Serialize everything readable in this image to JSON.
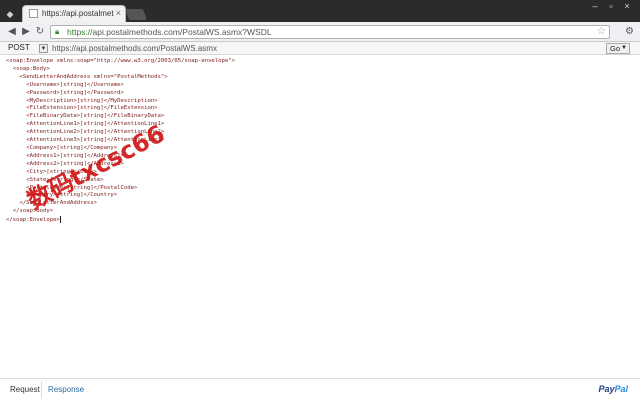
{
  "browser": {
    "tab_title": "https://api.postalmethods.com",
    "url_secure": "https://",
    "url_rest": "api.postalmethods.com/PostalWS.asmx?WSDL"
  },
  "request": {
    "method": "POST",
    "url": "https://api.postalmethods.com/PostalWS.asmx",
    "go_label": "Go"
  },
  "xml_lines": [
    "<soap:Envelope xmlns:soap=\"http://www.w3.org/2003/05/soap-envelope\">",
    "  <soap:Body>",
    "    <SendLetterAndAddress xmlns=\"PostalMethods\">",
    "      <Username>[string]</Username>",
    "      <Password>[string]</Password>",
    "      <MyDescription>[string]</MyDescription>",
    "      <FileExtension>[string]</FileExtension>",
    "      <FileBinaryData>[string]</FileBinaryData>",
    "      <AttentionLine1>[string]</AttentionLine1>",
    "      <AttentionLine2>[string]</AttentionLine2>",
    "      <AttentionLine3>[string]</AttentionLine3>",
    "      <Company>[string]</Company>",
    "      <Address1>[string]</Address1>",
    "      <Address2>[string]</Address2>",
    "      <City>[string]</City>",
    "      <State>[string]</State>",
    "      <PostalCode>[string]</PostalCode>",
    "      <Country>[string]</Country>",
    "    </SendLetterAndAddress>",
    "  </soap:Body>",
    "</soap:Envelope>"
  ],
  "watermark": "数码txcsc66",
  "bottom": {
    "request_tab": "Request",
    "response_tab": "Response",
    "brand_pay": "Pay",
    "brand_pal": "Pal"
  }
}
